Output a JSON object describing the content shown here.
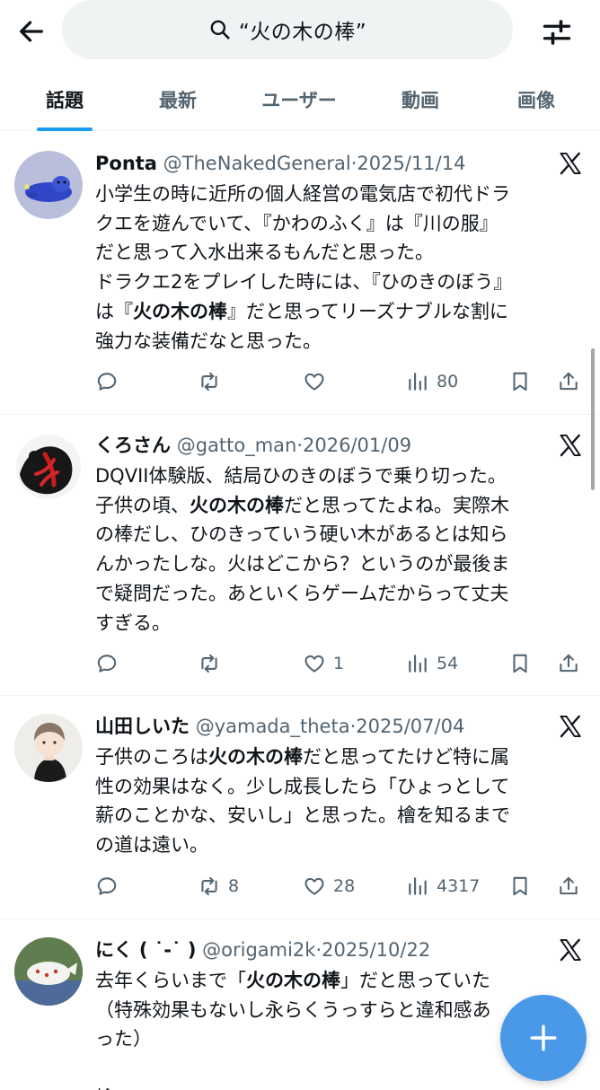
{
  "search": {
    "query": "“火の木の棒”"
  },
  "tabs": [
    {
      "label": "話題",
      "active": true
    },
    {
      "label": "最新"
    },
    {
      "label": "ユーザー"
    },
    {
      "label": "動画"
    },
    {
      "label": "画像"
    }
  ],
  "colors": {
    "accent": "#1d9bf0",
    "fab": "#4a99e9",
    "text": "#0f1419",
    "muted": "#536471"
  },
  "posts": [
    {
      "name": "Ponta",
      "handle": "@TheNakedGeneral",
      "date": "2025/11/14",
      "lines": [
        "小学生の時に近所の個人経営の電気店で初代ドラ",
        "クエを遊んでいて、『かわのふく』は『川の服』",
        "だと思って入水出来るもんだと思った。",
        "ドラクエ2をプレイした時には、『ひのきのぼう』",
        "は『**火の木の棒**』だと思ってリーズナブルな割に",
        "強力な装備だなと思った。"
      ],
      "stats": {
        "replies": "",
        "reposts": "",
        "likes": "",
        "views": "80"
      }
    },
    {
      "name": "くろさん",
      "handle": "@gatto_man",
      "date": "2026/01/09",
      "lines": [
        "DQVII体験版、結局ひのきのぼうで乗り切った。",
        "子供の頃、**火の木の棒**だと思ってたよね。実際木",
        "の棒だし、ひのきっていう硬い木があるとは知ら",
        "んかったしな。火はどこから？というのが最後ま",
        "で疑問だった。あといくらゲームだからって丈夫",
        "すぎる。"
      ],
      "stats": {
        "replies": "",
        "reposts": "",
        "likes": "1",
        "views": "54"
      }
    },
    {
      "name": "山田しいた",
      "handle": "@yamada_theta",
      "date": "2025/07/04",
      "lines": [
        "子供のころは**火の木の棒**だと思ってたけど特に属",
        "性の効果はなく。少し成長したら「ひょっとして",
        "薪のことかな、安いし」と思った。檜を知るまで",
        "の道は遠い。"
      ],
      "stats": {
        "replies": "",
        "reposts": "8",
        "likes": "28",
        "views": "4317"
      }
    },
    {
      "name": "にく ( ˙-˙ )",
      "handle": "@origami2k",
      "date": "2025/10/22",
      "lines": [
        "去年くらいまで「**火の木の棒**」だと思っていた",
        "（特殊効果もないし永らくうっすらと違和感あ",
        "った）",
        "",
        "檜"
      ],
      "stats": {
        "replies": "",
        "reposts": "",
        "likes": "",
        "views": ""
      }
    }
  ],
  "icons": {
    "back": "arrow-left-icon",
    "search": "search-icon",
    "filter": "filter-sliders-icon",
    "source": "x-logo-icon",
    "reply": "reply-icon",
    "repost": "repost-icon",
    "like": "heart-icon",
    "views": "views-chart-icon",
    "bookmark": "bookmark-icon",
    "share": "share-icon",
    "compose": "plus-icon"
  }
}
